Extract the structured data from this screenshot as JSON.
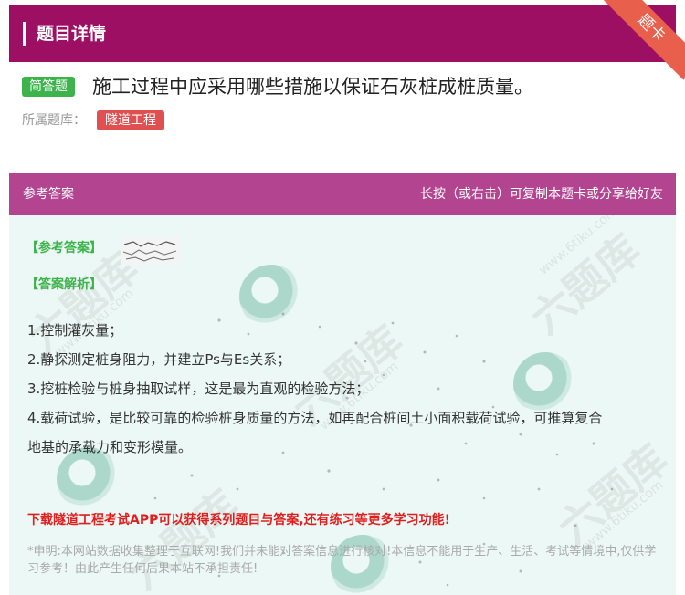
{
  "header": {
    "title": "题目详情",
    "ribbon": "题卡"
  },
  "question": {
    "type_tag": "简答题",
    "text": "施工过程中应采用哪些措施以保证石灰桩成桩质量。",
    "bank_label": "所属题库：",
    "bank_name": "隧道工程"
  },
  "answer": {
    "header_left": "参考答案",
    "header_right": "长按（或右击）可复制本题卡或分享给好友",
    "ref_label": "【参考答案】",
    "analysis_label": "【答案解析】",
    "items": [
      "1.控制灌灰量；",
      "2.静探测定桩身阻力，并建立Ps与Es关系；",
      "3.挖桩检验与桩身抽取试样，这是最为直观的检验方法；",
      "4.载荷试验，是比较可靠的检验桩身质量的方法，如再配合桩间土小面积载荷试验，可推算复合",
      "地基的承载力和变形模量。"
    ],
    "promo": "下载隧道工程考试APP可以获得系列题目与答案,还有练习等更多学习功能!",
    "disclaimer": "*申明:本网站数据收集整理于互联网!我们并未能对答案信息进行核对!本信息不能用于生产、生活、考试等情境中,仅供学习参考！由此产生任何后果本站不承担责任!"
  },
  "watermark": {
    "text": "六题库",
    "url": "www.6tiku.com"
  }
}
